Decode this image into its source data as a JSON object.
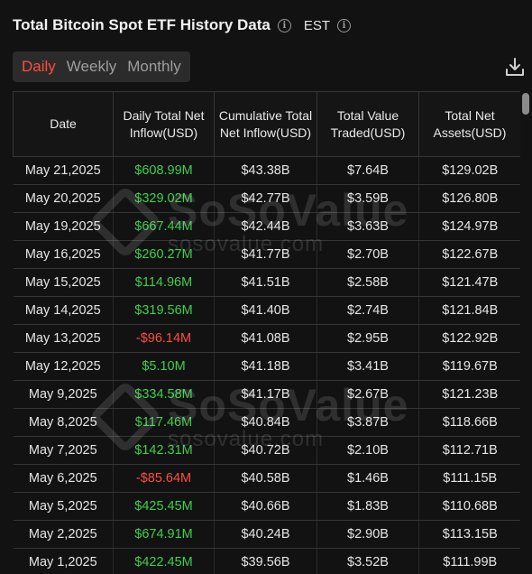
{
  "header": {
    "title": "Total Bitcoin Spot ETF History Data",
    "timezone": "EST"
  },
  "tabs": [
    {
      "label": "Daily",
      "active": true
    },
    {
      "label": "Weekly",
      "active": false
    },
    {
      "label": "Monthly",
      "active": false
    }
  ],
  "table": {
    "columns": [
      "Date",
      "Daily Total Net Inflow(USD)",
      "Cumulative Total Net Inflow(USD)",
      "Total Value Traded(USD)",
      "Total Net Assets(USD)"
    ],
    "rows": [
      {
        "date": "May 21,2025",
        "daily": "$608.99M",
        "sign": "pos",
        "cumulative": "$43.38B",
        "traded": "$7.64B",
        "assets": "$129.02B"
      },
      {
        "date": "May 20,2025",
        "daily": "$329.02M",
        "sign": "pos",
        "cumulative": "$42.77B",
        "traded": "$3.59B",
        "assets": "$126.80B"
      },
      {
        "date": "May 19,2025",
        "daily": "$667.44M",
        "sign": "pos",
        "cumulative": "$42.44B",
        "traded": "$3.63B",
        "assets": "$124.97B"
      },
      {
        "date": "May 16,2025",
        "daily": "$260.27M",
        "sign": "pos",
        "cumulative": "$41.77B",
        "traded": "$2.70B",
        "assets": "$122.67B"
      },
      {
        "date": "May 15,2025",
        "daily": "$114.96M",
        "sign": "pos",
        "cumulative": "$41.51B",
        "traded": "$2.58B",
        "assets": "$121.47B"
      },
      {
        "date": "May 14,2025",
        "daily": "$319.56M",
        "sign": "pos",
        "cumulative": "$41.40B",
        "traded": "$2.74B",
        "assets": "$121.84B"
      },
      {
        "date": "May 13,2025",
        "daily": "-$96.14M",
        "sign": "neg",
        "cumulative": "$41.08B",
        "traded": "$2.95B",
        "assets": "$122.92B"
      },
      {
        "date": "May 12,2025",
        "daily": "$5.10M",
        "sign": "pos",
        "cumulative": "$41.18B",
        "traded": "$3.41B",
        "assets": "$119.67B"
      },
      {
        "date": "May 9,2025",
        "daily": "$334.58M",
        "sign": "pos",
        "cumulative": "$41.17B",
        "traded": "$2.67B",
        "assets": "$121.23B"
      },
      {
        "date": "May 8,2025",
        "daily": "$117.46M",
        "sign": "pos",
        "cumulative": "$40.84B",
        "traded": "$3.87B",
        "assets": "$118.66B"
      },
      {
        "date": "May 7,2025",
        "daily": "$142.31M",
        "sign": "pos",
        "cumulative": "$40.72B",
        "traded": "$2.10B",
        "assets": "$112.71B"
      },
      {
        "date": "May 6,2025",
        "daily": "-$85.64M",
        "sign": "neg",
        "cumulative": "$40.58B",
        "traded": "$1.46B",
        "assets": "$111.15B"
      },
      {
        "date": "May 5,2025",
        "daily": "$425.45M",
        "sign": "pos",
        "cumulative": "$40.66B",
        "traded": "$1.83B",
        "assets": "$110.68B"
      },
      {
        "date": "May 2,2025",
        "daily": "$674.91M",
        "sign": "pos",
        "cumulative": "$40.24B",
        "traded": "$2.90B",
        "assets": "$113.15B"
      },
      {
        "date": "May 1,2025",
        "daily": "$422.45M",
        "sign": "pos",
        "cumulative": "$39.56B",
        "traded": "$3.52B",
        "assets": "$111.99B"
      }
    ]
  },
  "watermark": {
    "brand": "SoSoValue",
    "domain": "sosovalue.com"
  },
  "icons": {
    "info": "info-icon",
    "download": "download-icon"
  },
  "colors": {
    "accent": "#ff4e3c",
    "positive": "#3ecf4e",
    "negative": "#ff4e3c",
    "background": "#121212"
  }
}
